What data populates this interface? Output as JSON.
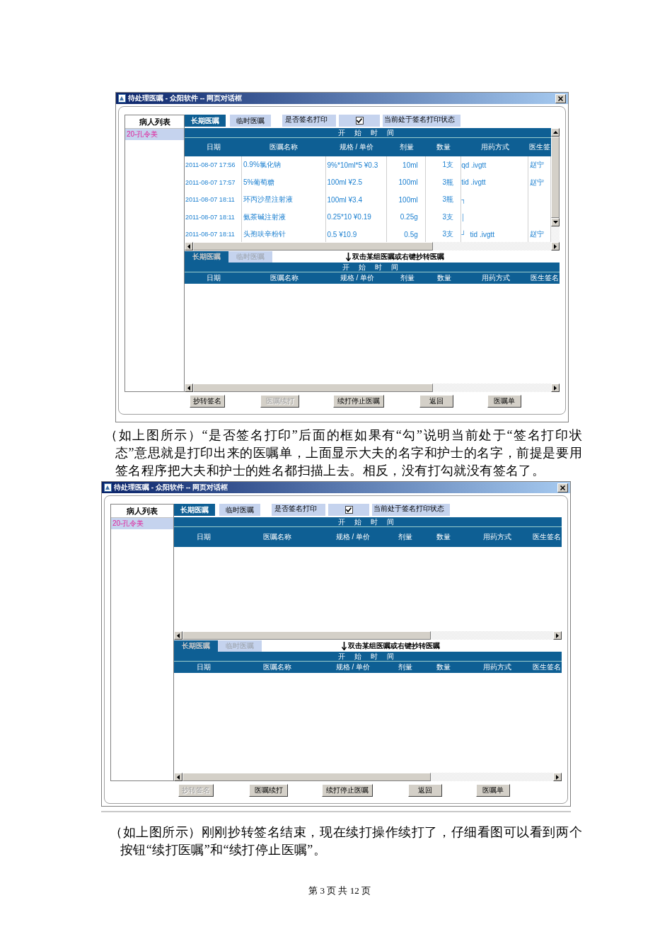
{
  "dialogs": [
    {
      "title": "待处理医嘱 - 众阳软件 -- 网页对话框",
      "patient_list": {
        "heading": "病人列表",
        "patients": [
          {
            "label": "20-孔令美",
            "selected": true
          }
        ]
      },
      "top_tabs": [
        {
          "label": "长期医嘱",
          "selected": true
        },
        {
          "label": "临时医嘱",
          "selected": false
        }
      ],
      "sign_print": {
        "label": "是否签名打印",
        "checked": true,
        "status": "当前处于签名打印状态"
      },
      "top_table": {
        "group_header": "开 始 时 间",
        "columns": [
          "日期",
          "医嘱名称",
          "规格 / 单价",
          "剂量",
          "数量",
          "用药方式",
          "医生签"
        ],
        "rows": [
          {
            "date": "2011-08-07 17:56",
            "name": "0.9%氯化钠",
            "spec": "9%*10ml*5 ¥0.3",
            "dose": "10ml",
            "qty": "1支",
            "usage": "qd .ivgtt",
            "doctor": "赵宁"
          },
          {
            "date": "2011-08-07 17:57",
            "name": "5%葡萄糖",
            "spec": "100ml ¥2.5",
            "dose": "100ml",
            "qty": "3瓶",
            "usage": "tid .ivgtt",
            "doctor": "赵宁"
          },
          {
            "date": "2011-08-07 18:11",
            "name": "环丙沙星注射液",
            "spec": "100ml ¥3.4",
            "dose": "100ml",
            "qty": "3瓶",
            "group_mark": "┐"
          },
          {
            "date": "2011-08-07 18:11",
            "name": "氨茶碱注射液",
            "spec": "0.25*10 ¥0.19",
            "dose": "0.25g",
            "qty": "3支",
            "group_mark": "│"
          },
          {
            "date": "2011-08-07 18:11",
            "name": "头孢呋辛粉针",
            "spec": "0.5 ¥10.9",
            "dose": "0.5g",
            "qty": "3支",
            "group_mark": "┘",
            "usage": "tid .ivgtt",
            "doctor": "赵宁"
          }
        ]
      },
      "bottom_tabs": [
        {
          "label": "长期医嘱",
          "selected": true,
          "disabled": true
        },
        {
          "label": "临时医嘱",
          "selected": false,
          "disabled": true
        }
      ],
      "hint": "双击某组医嘱或右键抄转医嘱",
      "bottom_table": {
        "group_header": "开 始 时 间",
        "columns": [
          "日期",
          "医嘱名称",
          "规格 / 单价",
          "剂量",
          "数量",
          "用药方式",
          "医生签名"
        ]
      },
      "buttons": [
        {
          "label": "抄转签名",
          "disabled": false
        },
        {
          "label": "医嘱续打",
          "disabled": true
        },
        {
          "label": "续打停止医嘱",
          "disabled": false
        },
        {
          "label": "返回",
          "disabled": false
        },
        {
          "label": "医嘱单",
          "disabled": false
        }
      ]
    },
    {
      "title": "待处理医嘱 - 众阳软件 -- 网页对话框",
      "patient_list": {
        "heading": "病人列表",
        "patients": [
          {
            "label": "20-孔令美",
            "selected": true
          }
        ]
      },
      "top_tabs": [
        {
          "label": "长期医嘱",
          "selected": true
        },
        {
          "label": "临时医嘱",
          "selected": false
        }
      ],
      "sign_print": {
        "label": "是否签名打印",
        "checked": true,
        "status": "当前处于签名打印状态"
      },
      "top_table": {
        "group_header": "开 始 时 间",
        "columns": [
          "日期",
          "医嘱名称",
          "规格 / 单价",
          "剂量",
          "数量",
          "用药方式",
          "医生签名"
        ]
      },
      "bottom_tabs": [
        {
          "label": "长期医嘱",
          "selected": true,
          "disabled": true
        },
        {
          "label": "临时医嘱",
          "selected": false,
          "disabled": true
        }
      ],
      "hint": "双击某组医嘱或右键抄转医嘱",
      "bottom_table": {
        "group_header": "开 始 时 间",
        "columns": [
          "日期",
          "医嘱名称",
          "规格 / 单价",
          "剂量",
          "数量",
          "用药方式",
          "医生签名"
        ]
      },
      "buttons": [
        {
          "label": "抄转签名",
          "disabled": true
        },
        {
          "label": "医嘱续打",
          "disabled": false
        },
        {
          "label": "续打停止医嘱",
          "disabled": false
        },
        {
          "label": "返回",
          "disabled": false
        },
        {
          "label": "医嘱单",
          "disabled": false
        }
      ]
    }
  ],
  "paragraphs": [
    "（如上图所示）“是否签名打印”后面的框如果有“勾”说明当前处于“签名打印状态”意思就是打印出来的医嘱单，上面显示大夫的名字和护士的名字，前提是要用签名程序把大夫和护士的姓名都扫描上去。相反，没有打勾就没有签名了。",
    "（如上图所示）刚刚抄转签名结束，现在续打操作续打了，仔细看图可以看到两个按钮“续打医嘱”和“续打停止医嘱”。"
  ],
  "footer": "第 3 页 共 12 页"
}
